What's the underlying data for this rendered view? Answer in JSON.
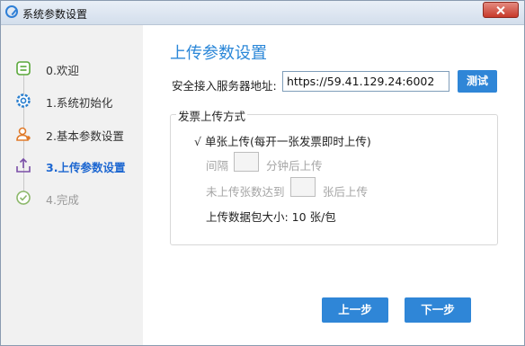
{
  "window": {
    "title": "系统参数设置"
  },
  "sidebar": {
    "steps": [
      {
        "label": "0.欢迎",
        "icon": "welcome-icon",
        "state": "done"
      },
      {
        "label": "1.系统初始化",
        "icon": "gear-icon",
        "state": "done"
      },
      {
        "label": "2.基本参数设置",
        "icon": "user-icon",
        "state": "done"
      },
      {
        "label": "3.上传参数设置",
        "icon": "upload-icon",
        "state": "active"
      },
      {
        "label": "4.完成",
        "icon": "check-circle-icon",
        "state": "pending"
      }
    ]
  },
  "main": {
    "heading": "上传参数设置",
    "server_label": "安全接入服务器地址:",
    "server_value": "https://59.41.129.24:6002",
    "test_button": "测试",
    "group_title": "发票上传方式",
    "single_option_check": "√",
    "single_option": "单张上传(每开一张发票即时上传)",
    "interval_prefix": "间隔",
    "interval_suffix": "分钟后上传",
    "count_prefix": "未上传张数达到",
    "count_suffix": "张后上传",
    "package_size": "上传数据包大小: 10 张/包"
  },
  "footer": {
    "prev_button": "上一步",
    "next_button": "下一步"
  },
  "colors": {
    "accent": "#2f86d7",
    "heading": "#2b87d8",
    "active_step": "#1d67d1",
    "sidebar_bg": "#f1f1f1"
  }
}
